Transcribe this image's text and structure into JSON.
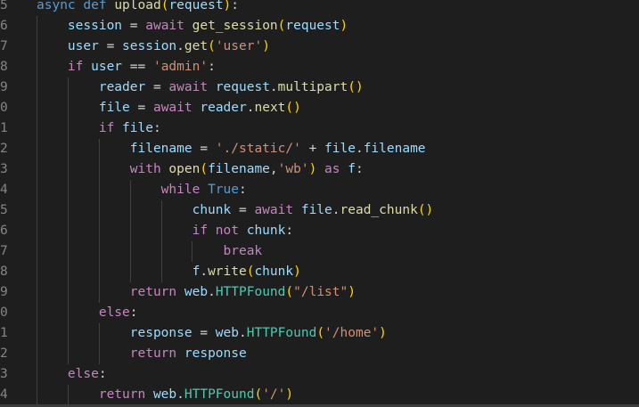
{
  "editor": {
    "line_numbers": [
      "5",
      "6",
      "7",
      "8",
      "9",
      "0",
      "1",
      "2",
      "3",
      "4",
      "5",
      "6",
      "7",
      "8",
      "9",
      "0",
      "1",
      "2",
      "3",
      "4"
    ],
    "lines": [
      [
        {
          "t": "async ",
          "c": "kw"
        },
        {
          "t": "def ",
          "c": "kw"
        },
        {
          "t": "upload",
          "c": "fn"
        },
        {
          "t": "(",
          "c": "p1"
        },
        {
          "t": "request",
          "c": "var"
        },
        {
          "t": ")",
          "c": "p1"
        },
        {
          "t": ":",
          "c": "op"
        }
      ],
      [
        {
          "t": "    session ",
          "c": "var"
        },
        {
          "t": "= ",
          "c": "op"
        },
        {
          "t": "await ",
          "c": "ctl"
        },
        {
          "t": "get_session",
          "c": "fn"
        },
        {
          "t": "(",
          "c": "p1"
        },
        {
          "t": "request",
          "c": "var"
        },
        {
          "t": ")",
          "c": "p1"
        }
      ],
      [
        {
          "t": "    user ",
          "c": "var"
        },
        {
          "t": "= ",
          "c": "op"
        },
        {
          "t": "session",
          "c": "var"
        },
        {
          "t": ".",
          "c": "op"
        },
        {
          "t": "get",
          "c": "fn"
        },
        {
          "t": "(",
          "c": "p1"
        },
        {
          "t": "'user'",
          "c": "str"
        },
        {
          "t": ")",
          "c": "p1"
        }
      ],
      [
        {
          "t": "    if ",
          "c": "ctl"
        },
        {
          "t": "user ",
          "c": "var"
        },
        {
          "t": "== ",
          "c": "op"
        },
        {
          "t": "'admin'",
          "c": "str"
        },
        {
          "t": ":",
          "c": "op"
        }
      ],
      [
        {
          "t": "        reader ",
          "c": "var"
        },
        {
          "t": "= ",
          "c": "op"
        },
        {
          "t": "await ",
          "c": "ctl"
        },
        {
          "t": "request",
          "c": "var"
        },
        {
          "t": ".",
          "c": "op"
        },
        {
          "t": "multipart",
          "c": "fn"
        },
        {
          "t": "()",
          "c": "p1"
        }
      ],
      [
        {
          "t": "        file ",
          "c": "var"
        },
        {
          "t": "= ",
          "c": "op"
        },
        {
          "t": "await ",
          "c": "ctl"
        },
        {
          "t": "reader",
          "c": "var"
        },
        {
          "t": ".",
          "c": "op"
        },
        {
          "t": "next",
          "c": "fn"
        },
        {
          "t": "()",
          "c": "p1"
        }
      ],
      [
        {
          "t": "        if ",
          "c": "ctl"
        },
        {
          "t": "file",
          "c": "var"
        },
        {
          "t": ":",
          "c": "op"
        }
      ],
      [
        {
          "t": "            filename ",
          "c": "var"
        },
        {
          "t": "= ",
          "c": "op"
        },
        {
          "t": "'./static/' ",
          "c": "str"
        },
        {
          "t": "+ ",
          "c": "op"
        },
        {
          "t": "file",
          "c": "var"
        },
        {
          "t": ".",
          "c": "op"
        },
        {
          "t": "filename",
          "c": "var"
        }
      ],
      [
        {
          "t": "            with ",
          "c": "ctl"
        },
        {
          "t": "open",
          "c": "fn"
        },
        {
          "t": "(",
          "c": "p1"
        },
        {
          "t": "filename",
          "c": "var"
        },
        {
          "t": ",",
          "c": "op"
        },
        {
          "t": "'wb'",
          "c": "str"
        },
        {
          "t": ") ",
          "c": "p1"
        },
        {
          "t": "as ",
          "c": "ctl"
        },
        {
          "t": "f",
          "c": "var"
        },
        {
          "t": ":",
          "c": "op"
        }
      ],
      [
        {
          "t": "                while ",
          "c": "ctl"
        },
        {
          "t": "True",
          "c": "kw"
        },
        {
          "t": ":",
          "c": "op"
        }
      ],
      [
        {
          "t": "                    chunk ",
          "c": "var"
        },
        {
          "t": "= ",
          "c": "op"
        },
        {
          "t": "await ",
          "c": "ctl"
        },
        {
          "t": "file",
          "c": "var"
        },
        {
          "t": ".",
          "c": "op"
        },
        {
          "t": "read_chunk",
          "c": "fn"
        },
        {
          "t": "()",
          "c": "p1"
        }
      ],
      [
        {
          "t": "                    if ",
          "c": "ctl"
        },
        {
          "t": "not ",
          "c": "ctl"
        },
        {
          "t": "chunk",
          "c": "var"
        },
        {
          "t": ":",
          "c": "op"
        }
      ],
      [
        {
          "t": "                        break",
          "c": "ctl"
        }
      ],
      [
        {
          "t": "                    f",
          "c": "var"
        },
        {
          "t": ".",
          "c": "op"
        },
        {
          "t": "write",
          "c": "fn"
        },
        {
          "t": "(",
          "c": "p1"
        },
        {
          "t": "chunk",
          "c": "var"
        },
        {
          "t": ")",
          "c": "p1"
        }
      ],
      [
        {
          "t": "            return ",
          "c": "ctl"
        },
        {
          "t": "web",
          "c": "var"
        },
        {
          "t": ".",
          "c": "op"
        },
        {
          "t": "HTTPFound",
          "c": "cls"
        },
        {
          "t": "(",
          "c": "p1"
        },
        {
          "t": "\"/list\"",
          "c": "str"
        },
        {
          "t": ")",
          "c": "p1"
        }
      ],
      [
        {
          "t": "        else",
          "c": "ctl"
        },
        {
          "t": ":",
          "c": "op"
        }
      ],
      [
        {
          "t": "            response ",
          "c": "var"
        },
        {
          "t": "= ",
          "c": "op"
        },
        {
          "t": "web",
          "c": "var"
        },
        {
          "t": ".",
          "c": "op"
        },
        {
          "t": "HTTPFound",
          "c": "cls"
        },
        {
          "t": "(",
          "c": "p1"
        },
        {
          "t": "'/home'",
          "c": "str"
        },
        {
          "t": ")",
          "c": "p1"
        }
      ],
      [
        {
          "t": "            return ",
          "c": "ctl"
        },
        {
          "t": "response",
          "c": "var"
        }
      ],
      [
        {
          "t": "    else",
          "c": "ctl"
        },
        {
          "t": ":",
          "c": "op"
        }
      ],
      [
        {
          "t": "        return ",
          "c": "ctl"
        },
        {
          "t": "web",
          "c": "var"
        },
        {
          "t": ".",
          "c": "op"
        },
        {
          "t": "HTTPFound",
          "c": "cls"
        },
        {
          "t": "(",
          "c": "p1"
        },
        {
          "t": "'/'",
          "c": "str"
        },
        {
          "t": ")",
          "c": "p1"
        }
      ]
    ]
  },
  "colors": {
    "background": "#1e1e1e",
    "line_number": "#858585",
    "keyword": "#569cd6",
    "control": "#c586c0",
    "function": "#dcdcaa",
    "variable": "#9cdcfe",
    "string": "#ce9178",
    "class": "#4ec9b0",
    "bracket": "#ffd700"
  }
}
